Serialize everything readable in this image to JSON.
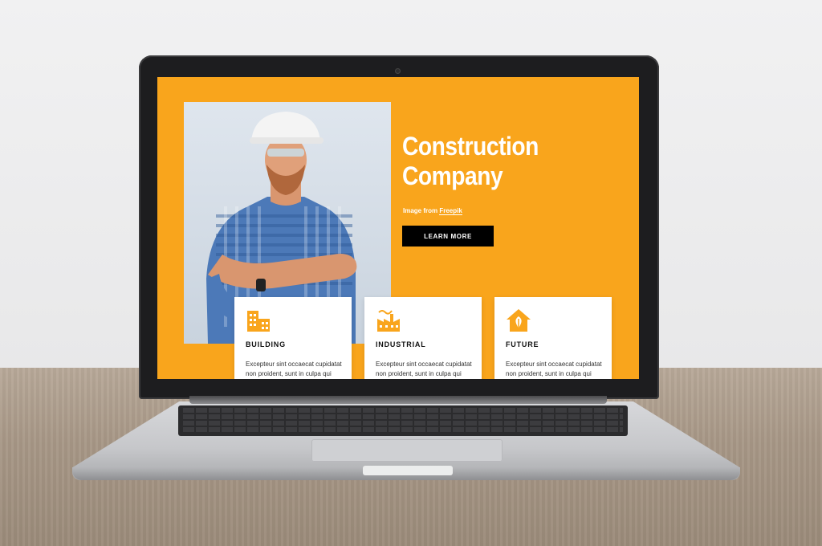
{
  "site": {
    "hero": {
      "title_line1": "Construction",
      "title_line2": "Company",
      "credit_prefix": "Image from ",
      "credit_link": "Freepik",
      "cta_label": "LEARN MORE"
    },
    "cards": [
      {
        "icon": "building-icon",
        "title": "BUILDING",
        "text": "Excepteur sint occaecat cupidatat non proident, sunt in culpa qui"
      },
      {
        "icon": "factory-icon",
        "title": "INDUSTRIAL",
        "text": "Excepteur sint occaecat cupidatat non proident, sunt in culpa qui"
      },
      {
        "icon": "eco-house-icon",
        "title": "FUTURE",
        "text": "Excepteur sint occaecat cupidatat non proident, sunt in culpa qui"
      }
    ]
  },
  "colors": {
    "accent": "#f9a51c",
    "button": "#000000",
    "card": "#ffffff"
  }
}
